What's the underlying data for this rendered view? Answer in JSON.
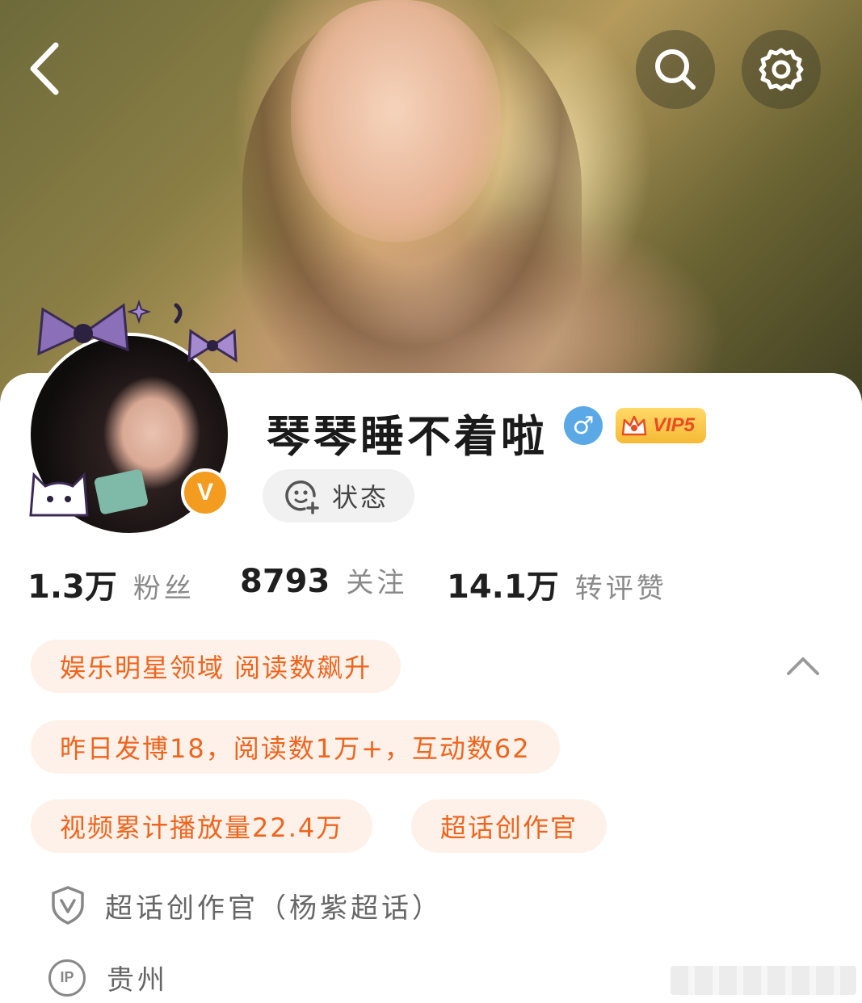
{
  "profile": {
    "name": "琴琴睡不着啦",
    "gender_symbol": "♂",
    "vip_label": "VIP5",
    "status_label": "状态",
    "verify_symbol": "V"
  },
  "stats": [
    {
      "value": "1.3万",
      "label": "粉丝"
    },
    {
      "value": "8793",
      "label": "关注"
    },
    {
      "value": "14.1万",
      "label": "转评赞"
    }
  ],
  "tags": [
    "娱乐明星领域 阅读数飙升",
    "昨日发博18，阅读数1万+，互动数62",
    "视频累计播放量22.4万",
    "超话创作官"
  ],
  "info": {
    "certification": "超话创作官（杨紫超话）",
    "ip_badge": "IP",
    "ip_location": "贵州"
  },
  "colors": {
    "accent": "#f0641c",
    "tag_bg": "#fdf1ea",
    "verify_badge": "#f39c20",
    "gender_badge": "#5aa8e6",
    "vip_badge": "#f6b935"
  },
  "icons": {
    "back": "chevron-left-icon",
    "search": "search-icon",
    "settings": "gear-icon",
    "status": "smiley-plus-icon",
    "collapse": "chevron-up-icon",
    "certification": "shield-v-icon",
    "ip": "ip-location-icon"
  }
}
